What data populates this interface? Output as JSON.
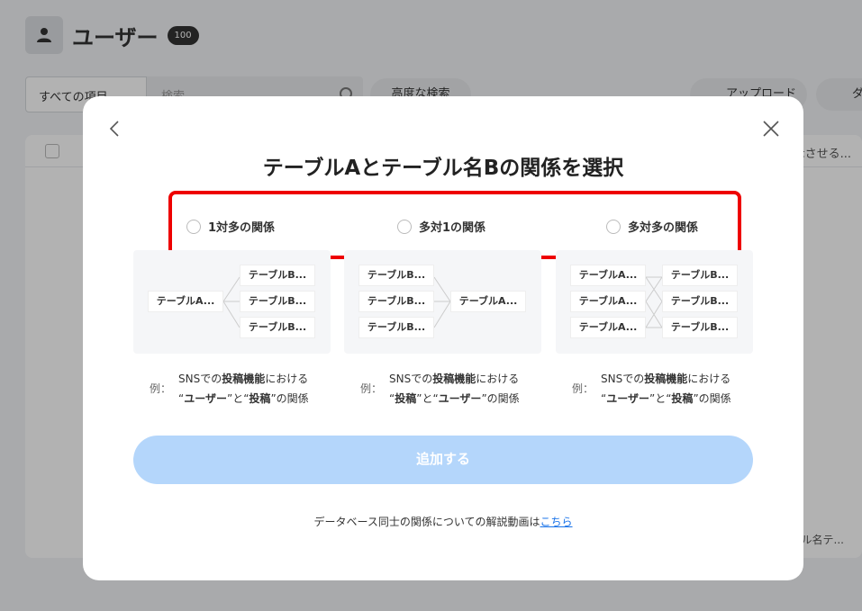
{
  "background": {
    "title": "ユーザー",
    "count": "100",
    "select_value": "すべての項目",
    "search_placeholder": "検索",
    "advanced_search": "高度な検索",
    "upload": "アップロード",
    "download": "ダ",
    "table_header_tail": "表示させる...",
    "table_cell_tail": "ル名テ..."
  },
  "modal": {
    "title": "テーブルAとテーブル名Bの関係を選択",
    "options": [
      {
        "label": "1対多の関係"
      },
      {
        "label": "多対1の関係"
      },
      {
        "label": "多対多の関係"
      }
    ],
    "diagram_labels": {
      "a": "テーブルA...",
      "b": "テーブルB..."
    },
    "examples": [
      {
        "prefix": "例：",
        "l1_a": "SNSでの",
        "l1_b": "投稿機能",
        "l1_c": "における",
        "l2_a": "“",
        "l2_b": "ユーザー",
        "l2_c": "”と“",
        "l2_d": "投稿",
        "l2_e": "”の関係"
      },
      {
        "prefix": "例：",
        "l1_a": "SNSでの",
        "l1_b": "投稿機能",
        "l1_c": "における",
        "l2_a": "“",
        "l2_b": "投稿",
        "l2_c": "”と“",
        "l2_d": "ユーザー",
        "l2_e": "”の関係"
      },
      {
        "prefix": "例：",
        "l1_a": "SNSでの",
        "l1_b": "投稿機能",
        "l1_c": "における",
        "l2_a": "“",
        "l2_b": "ユーザー",
        "l2_c": "”と“",
        "l2_d": "投稿",
        "l2_e": "”の関係"
      }
    ],
    "add_button": "追加する",
    "footer_text": "データベース同士の関係についての解説動画は",
    "footer_link": "こちら"
  },
  "colors": {
    "highlight": "#e00000",
    "button_disabled": "#b4d6fb",
    "link": "#1a73e8"
  }
}
